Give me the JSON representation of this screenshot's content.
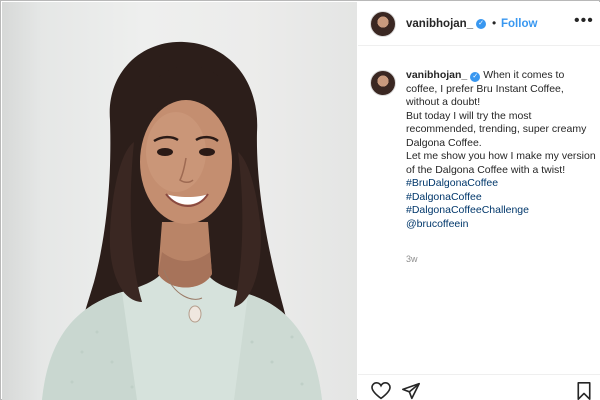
{
  "post": {
    "username": "vanibhojan_",
    "follow_label": "Follow",
    "separator": "•",
    "more_label": "•••",
    "verified_mark": "✓",
    "caption_lines": [
      "When it comes to coffee, I prefer Bru Instant Coffee, without a doubt!",
      "But today I will try the most recommended, trending, super creamy Dalgona Coffee.",
      "Let me show you how I make my version of the Dalgona Coffee with a twist!"
    ],
    "hashtags": [
      "#BruDalgonaCoffee",
      "#DalgonaCoffee",
      "#DalgonaCoffeeChallenge",
      "@brucoffeein"
    ],
    "age": "3w"
  },
  "icons": {
    "like": "heart-icon",
    "share": "share-icon",
    "save": "bookmark-icon",
    "verified": "verified-badge-icon"
  },
  "colors": {
    "link": "#00376b",
    "follow": "#3897f0",
    "verified": "#3897f0",
    "muted": "#8e8e8e"
  }
}
